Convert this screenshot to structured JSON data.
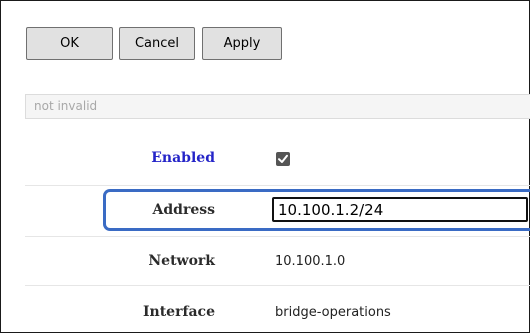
{
  "toolbar": {
    "ok_label": "OK",
    "cancel_label": "Cancel",
    "apply_label": "Apply"
  },
  "status": {
    "text": "not invalid"
  },
  "form": {
    "enabled": {
      "label": "Enabled",
      "checked": true
    },
    "address": {
      "label": "Address",
      "value": "10.100.1.2/24"
    },
    "network": {
      "label": "Network",
      "value": "10.100.1.0"
    },
    "interface": {
      "label": "Interface",
      "value": "bridge-operations"
    }
  },
  "colors": {
    "enabled_label": "#2424c8",
    "focus_ring": "#3a6bc4",
    "button_bg": "#e1e1e1"
  }
}
